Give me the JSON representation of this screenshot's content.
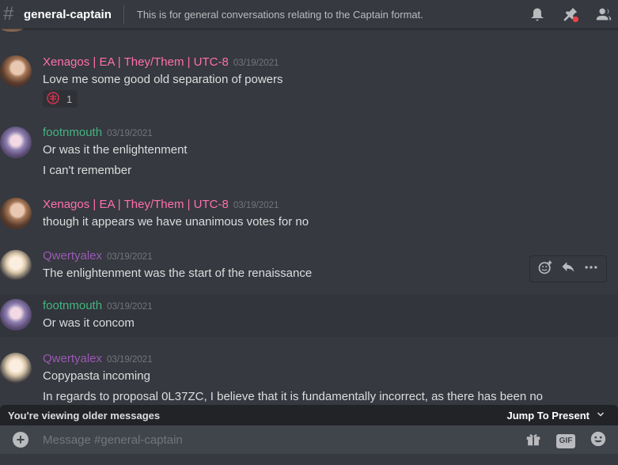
{
  "header": {
    "channel_name": "general-captain",
    "topic": "This is for general conversations relating to the Captain format."
  },
  "messages": [
    {
      "username": "Xenagos | EA | They/Them | UTC-8",
      "timestamp": "03/19/2021",
      "lines": [
        "Love me some good old separation of powers"
      ],
      "reaction": {
        "icon": "seal-emoji-icon",
        "count": "1"
      }
    },
    {
      "username": "footnmouth",
      "timestamp": "03/19/2021",
      "lines": [
        "Or was it the enlightenment",
        "I can't remember"
      ]
    },
    {
      "username": "Xenagos | EA | They/Them | UTC-8",
      "timestamp": "03/19/2021",
      "lines": [
        "though it appears we have unanimous votes for no"
      ]
    },
    {
      "username": "Qwertyalex",
      "timestamp": "03/19/2021",
      "lines": [
        "The enlightenment was the start of the renaissance"
      ]
    },
    {
      "username": "footnmouth",
      "timestamp": "03/19/2021",
      "lines": [
        "Or was it concom"
      ]
    },
    {
      "username": "Qwertyalex",
      "timestamp": "03/19/2021",
      "lines": [
        "Copypasta incoming",
        "In regards to proposal 0L37ZC, I believe that it is fundamentally incorrect, as there has been no"
      ]
    }
  ],
  "older_bar": {
    "label": "You're viewing older messages",
    "jump_label": "Jump To Present"
  },
  "composer": {
    "placeholder": "Message #general-captain",
    "gif_label": "GIF"
  },
  "colors": {
    "background": "#36393f",
    "username_pink": "#ff6fb0",
    "username_green": "#43b581",
    "username_purple": "#9b59b6"
  }
}
